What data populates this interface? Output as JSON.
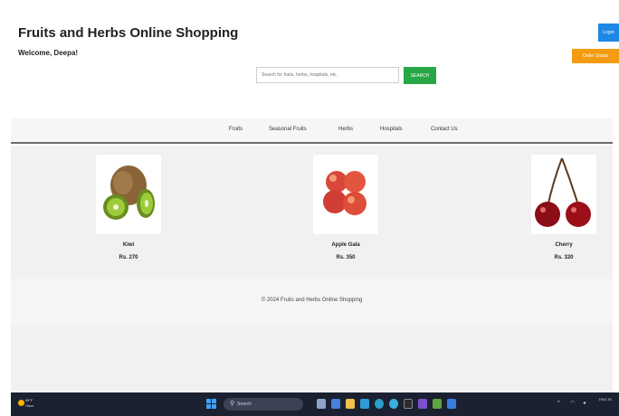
{
  "header": {
    "title": "Fruits and Herbs Online Shopping",
    "welcome": "Welcome, Deepa!",
    "login_label": "Login",
    "orders_label": "Order Status"
  },
  "search": {
    "placeholder": "Search for fruits, herbs, hospitals, etc.",
    "button_label": "SEARCH"
  },
  "nav": {
    "items": [
      {
        "label": "Fruits"
      },
      {
        "label": "Seasonal Fruits"
      },
      {
        "label": "Herbs"
      },
      {
        "label": "Hospitals"
      },
      {
        "label": "Contact Us"
      }
    ]
  },
  "products": [
    {
      "name": "Kiwi",
      "price": "Rs. 270"
    },
    {
      "name": "Apple Gala",
      "price": "Rs. 350"
    },
    {
      "name": "Cherry",
      "price": "Rs. 320"
    }
  ],
  "footer": {
    "text": "© 2024 Fruits and Herbs Online Shopping"
  },
  "taskbar": {
    "weather_temp": "88°F",
    "weather_condition": "Haze",
    "search_label": "Search",
    "clock": "ENG IN"
  },
  "colors": {
    "search_button": "#27a745",
    "login_button": "#1e88e5",
    "orders_button": "#f39c12",
    "taskbar": "#1b2130"
  }
}
